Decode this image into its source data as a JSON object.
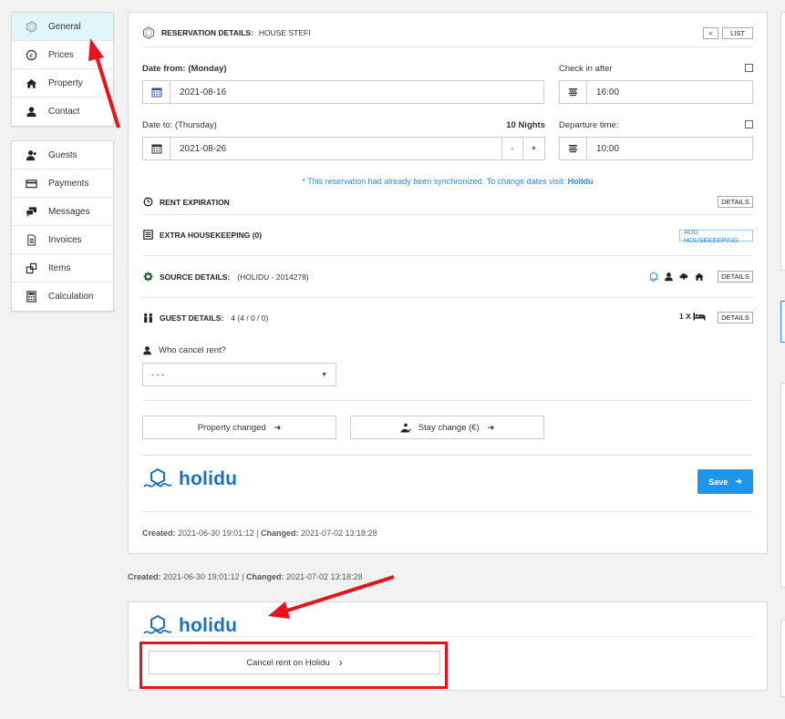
{
  "sidebar": {
    "group1": [
      {
        "label": "General",
        "icon": "hexagon-icon",
        "active": true
      },
      {
        "label": "Prices",
        "icon": "euro-icon"
      },
      {
        "label": "Property",
        "icon": "house-icon"
      },
      {
        "label": "Contact",
        "icon": "person-icon"
      }
    ],
    "group2": [
      {
        "label": "Guests",
        "icon": "guests-icon"
      },
      {
        "label": "Payments",
        "icon": "card-icon"
      },
      {
        "label": "Messages",
        "icon": "chat-icon"
      },
      {
        "label": "Invoices",
        "icon": "document-icon"
      },
      {
        "label": "Items",
        "icon": "items-icon"
      },
      {
        "label": "Calculation",
        "icon": "calculator-icon"
      }
    ]
  },
  "reservation": {
    "header_title": "RESERVATION DETAILS:",
    "header_property": "HOUSE STEFI",
    "back_label": "<",
    "list_label": "LIST",
    "date_from_label": "Date from:",
    "date_from_day": "(Monday)",
    "date_from_value": "2021-08-16",
    "checkin_label": "Check in after",
    "checkin_value": "16:00",
    "date_to_label": "Date to: (Thursday)",
    "nights": "10 Nights",
    "date_to_value": "2021-08-26",
    "minus_label": "-",
    "plus_label": "+",
    "departure_label": "Departure time:",
    "departure_value": "10:00",
    "sync_notice": "* This reservation had already been synchronized. To change dates visit:",
    "sync_link": "Holidu"
  },
  "sections": {
    "rent_expiration": "RENT EXPIRATION",
    "extra_housekeeping": "EXTRA HOUSEKEEPING (0)",
    "add_housekeeping": "ADD HOUSEKEEPING",
    "source_title": "SOURCE DETAILS:",
    "source_value": "(HOLIDU - 2014278)",
    "guest_title": "GUEST DETAILS:",
    "guest_value": "4  (4 / 0 / 0)",
    "bed_count": "1 X",
    "details": "DETAILS"
  },
  "cancel": {
    "label": "Who cancel rent?",
    "select_value": "- - -"
  },
  "actions": {
    "property_changed": "Property changed",
    "stay_change": "Stay change (€)",
    "save": "Save"
  },
  "brand": {
    "name": "holidu",
    "color": "#1b71c2"
  },
  "footer": {
    "created_label": "Created:",
    "created_value": "2021-06-30 19:01:12",
    "separator": "|",
    "changed_label": "Changed:",
    "changed_value": "2021-07-02 13:18:28"
  },
  "holidu_panel": {
    "cancel_button": "Cancel rent on Holidu",
    "chevron": "›"
  },
  "colors": {
    "accent": "#1e95ec",
    "active_bg": "#dff7fb",
    "annotation_red": "#e8121b"
  }
}
